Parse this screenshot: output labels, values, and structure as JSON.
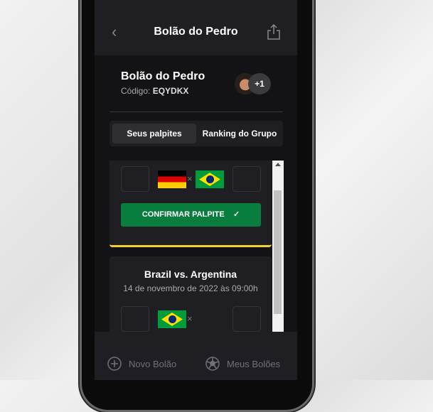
{
  "header": {
    "title": "Bolão do Pedro"
  },
  "group": {
    "name": "Bolão do Pedro",
    "code_label": "Código:",
    "code": "EQYDKX",
    "extra_members": "+1"
  },
  "tabs": [
    {
      "label": "Seus palpites"
    },
    {
      "label": "Ranking do Grupo"
    }
  ],
  "matches": [
    {
      "home_flag": "germany",
      "away_flag": "brazil",
      "separator": "×",
      "confirm_label": "CONFIRMAR PALPITE",
      "accent": "#f2d12e"
    },
    {
      "title": "Brazil vs. Argentina",
      "date": "14 de novembro de 2022 às 09:00h",
      "home_flag": "brazil",
      "separator": "×"
    }
  ],
  "bottom_nav": [
    {
      "label": "Novo Bolão",
      "icon": "plus-circle-icon"
    },
    {
      "label": "Meus Bolões",
      "icon": "soccer-ball-icon"
    }
  ],
  "colors": {
    "button": "#087d3d",
    "accent": "#f2d12e"
  }
}
